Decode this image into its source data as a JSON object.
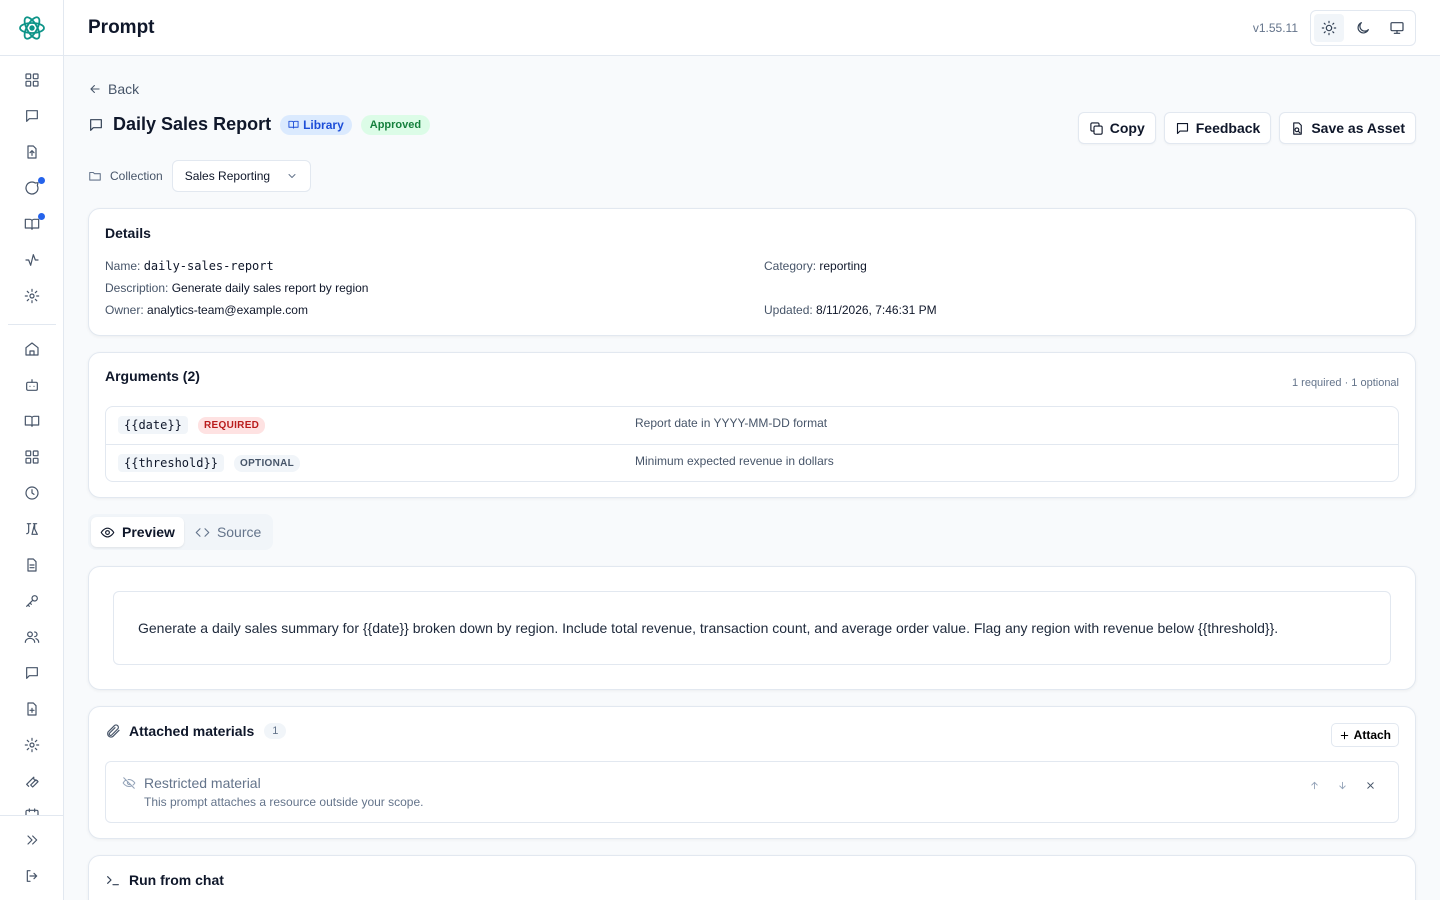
{
  "app": {
    "title": "Prompt",
    "version": "v1.55.11"
  },
  "theme": {
    "options": [
      "light",
      "dark",
      "system"
    ],
    "selected": "light"
  },
  "sidebar": {
    "top_items": [
      {
        "icon": "grid-icon",
        "label": "dashboard"
      },
      {
        "icon": "message-icon",
        "label": "chat"
      },
      {
        "icon": "file-upload-icon",
        "label": "uploads"
      },
      {
        "icon": "chat-bubble-icon",
        "label": "conversations",
        "notification": true
      },
      {
        "icon": "book-icon",
        "label": "library",
        "notification": true
      },
      {
        "icon": "activity-icon",
        "label": "activity"
      },
      {
        "icon": "gear-icon",
        "label": "settings"
      }
    ],
    "bottom_items": [
      {
        "icon": "home-icon"
      },
      {
        "icon": "bot-icon"
      },
      {
        "icon": "book-open-icon"
      },
      {
        "icon": "apps-icon"
      },
      {
        "icon": "clock-icon"
      },
      {
        "icon": "flask-icon"
      },
      {
        "icon": "document-icon"
      },
      {
        "icon": "key-icon"
      },
      {
        "icon": "users-icon"
      },
      {
        "icon": "message-square-icon"
      },
      {
        "icon": "file-plus-icon"
      },
      {
        "icon": "cog-icon"
      },
      {
        "icon": "wrench-icon"
      }
    ]
  },
  "nav": {
    "back_label": "Back"
  },
  "prompt": {
    "title": "Daily Sales Report",
    "library_badge": "Library",
    "status_badge": "Approved"
  },
  "actions": {
    "copy": "Copy",
    "feedback": "Feedback",
    "save_asset": "Save as Asset"
  },
  "collection": {
    "label": "Collection",
    "selected": "Sales Reporting"
  },
  "details": {
    "title": "Details",
    "name_label": "Name:",
    "name_value": "daily-sales-report",
    "description_label": "Description:",
    "description_value": "Generate daily sales report by region",
    "owner_label": "Owner:",
    "owner_value": "analytics-team@example.com",
    "category_label": "Category:",
    "category_value": "reporting",
    "updated_label": "Updated:",
    "updated_value": "8/11/2026, 7:46:31 PM"
  },
  "arguments": {
    "title": "Arguments (2)",
    "summary": "1 required · 1 optional",
    "rows": [
      {
        "name": "{{date}}",
        "badge": "REQUIRED",
        "description": "Report date in YYYY-MM-DD format"
      },
      {
        "name": "{{threshold}}",
        "badge": "OPTIONAL",
        "description": "Minimum expected revenue in dollars"
      }
    ]
  },
  "tabs": {
    "preview": "Preview",
    "source": "Source",
    "active": "preview"
  },
  "preview": {
    "text": "Generate a daily sales summary for {{date}} broken down by region. Include total revenue, transaction count, and average order value. Flag any region with revenue below {{threshold}}."
  },
  "attached": {
    "title": "Attached materials",
    "count": "1",
    "attach_label": "Attach",
    "items": [
      {
        "title": "Restricted material",
        "subtitle": "This prompt attaches a resource outside your scope."
      }
    ]
  },
  "run": {
    "title": "Run from chat"
  },
  "colors": {
    "accent": "#2563eb",
    "library_bg": "#dbeafe",
    "approved_bg": "#dcfce7",
    "required_bg": "#fee2e2"
  }
}
